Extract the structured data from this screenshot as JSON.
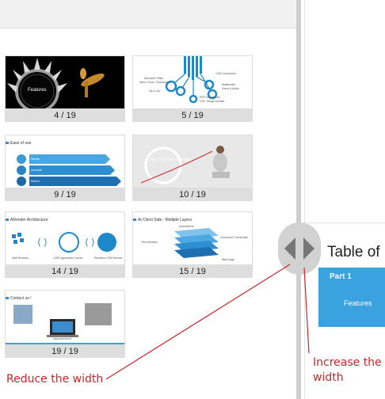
{
  "slides": [
    {
      "caption": "4 / 19",
      "label": "Features"
    },
    {
      "caption": "5 / 19",
      "labels": [
        "Microsoft Office",
        "Word, Excel, Powerpoint",
        "Zip & Jar",
        "CAD Documents",
        "Multimedia",
        "Video & Audio",
        "PDF Documents",
        "100+ Image formats"
      ]
    },
    {
      "caption": "9 / 19",
      "title": "Ease of use",
      "items": [
        "Render",
        "Annotate",
        "Search"
      ]
    },
    {
      "caption": "10 / 19",
      "label": "Key Customer Benefits"
    },
    {
      "caption": "14 / 19",
      "title": "ARender Architecture",
      "items": [
        "Web Browser",
        "J2EE Application Server",
        "Rendition JVM Service"
      ]
    },
    {
      "caption": "15 / 19",
      "title": "At Client Side : Multiple Layers",
      "items": [
        "Annotations",
        "Text selection",
        "Document Thumbnails",
        "Web page"
      ]
    },
    {
      "caption": "19 / 19",
      "title": "Contact us !",
      "items": [
        "www.arender.fr"
      ]
    }
  ],
  "preview": {
    "toc_title": "Table of",
    "part_label": "Part 1",
    "part_item": "Features"
  },
  "annotations": {
    "reduce": "Reduce the width",
    "increase": [
      "Increase the",
      "width"
    ],
    "color": "#c62828"
  },
  "colors": {
    "accent": "#3aa2df",
    "caption_bg": "#dedede",
    "divider": "#cfcfcf",
    "handle": "#d2d2d2"
  }
}
